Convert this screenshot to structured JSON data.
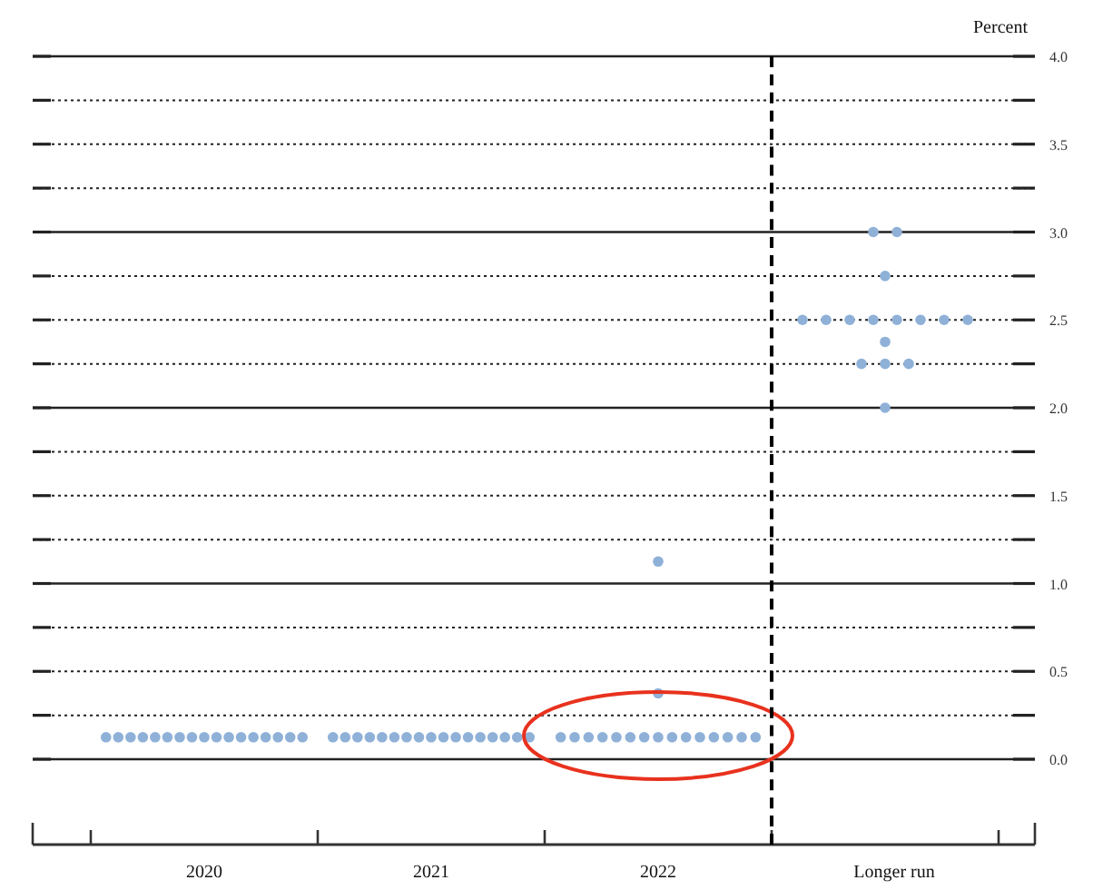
{
  "chart_data": {
    "type": "scatter",
    "ylabel": "Percent",
    "categories": [
      "2020",
      "2021",
      "2022",
      "Longer run"
    ],
    "series": [
      {
        "color": "#8fb1d8",
        "values": [
          0.125,
          0.125,
          0.125,
          2.0
        ]
      },
      {
        "color": "#8fb1d8",
        "values": [
          0.125,
          0.125,
          0.125,
          2.25
        ]
      },
      {
        "color": "#8fb1d8",
        "values": [
          0.125,
          0.125,
          0.125,
          2.25
        ]
      },
      {
        "color": "#8fb1d8",
        "values": [
          0.125,
          0.125,
          0.125,
          2.25
        ]
      },
      {
        "color": "#8fb1d8",
        "values": [
          0.125,
          0.125,
          0.125,
          2.375
        ]
      },
      {
        "color": "#8fb1d8",
        "values": [
          0.125,
          0.125,
          0.125,
          2.5
        ]
      },
      {
        "color": "#8fb1d8",
        "values": [
          0.125,
          0.125,
          0.125,
          2.5
        ]
      },
      {
        "color": "#8fb1d8",
        "values": [
          0.125,
          0.125,
          0.125,
          2.5
        ]
      },
      {
        "color": "#8fb1d8",
        "values": [
          0.125,
          0.125,
          0.125,
          2.5
        ]
      },
      {
        "color": "#8fb1d8",
        "values": [
          0.125,
          0.125,
          0.125,
          2.5
        ]
      },
      {
        "color": "#8fb1d8",
        "values": [
          0.125,
          0.125,
          0.125,
          2.5
        ]
      },
      {
        "color": "#8fb1d8",
        "values": [
          0.125,
          0.125,
          0.125,
          2.5
        ]
      },
      {
        "color": "#8fb1d8",
        "values": [
          0.125,
          0.125,
          0.125,
          2.5
        ]
      },
      {
        "color": "#8fb1d8",
        "values": [
          0.125,
          0.125,
          0.125,
          2.75
        ]
      },
      {
        "color": "#8fb1d8",
        "values": [
          0.125,
          0.125,
          0.125,
          3.0
        ]
      },
      {
        "color": "#8fb1d8",
        "values": [
          0.125,
          0.125,
          0.375,
          3.0
        ]
      },
      {
        "color": "#8fb1d8",
        "values": [
          0.125,
          0.125,
          1.125,
          null
        ]
      }
    ],
    "ylim": [
      0,
      4
    ],
    "grid": true,
    "yticks": [
      {
        "value": 0,
        "label": "0.0"
      },
      {
        "value": 0.5,
        "label": "0.5"
      },
      {
        "value": 1,
        "label": "1.0"
      },
      {
        "value": 1.5,
        "label": "1.5"
      },
      {
        "value": 2,
        "label": "2.0"
      },
      {
        "value": 2.5,
        "label": "2.5"
      },
      {
        "value": 3,
        "label": "3.0"
      },
      {
        "value": 3.5,
        "label": "3.5"
      },
      {
        "value": 4,
        "label": "4.0"
      }
    ]
  }
}
